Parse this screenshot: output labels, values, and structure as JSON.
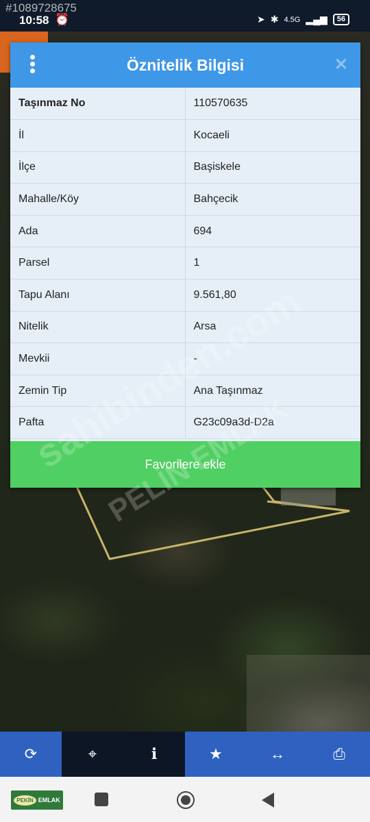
{
  "overlay_id": "#1089728675",
  "status_bar": {
    "time": "10:58",
    "network": "4.5G",
    "battery": "56"
  },
  "dialog": {
    "title": "Öznitelik Bilgisi",
    "close_symbol": "✕",
    "rows": [
      {
        "key": "Taşınmaz No",
        "value": "110570635"
      },
      {
        "key": "İl",
        "value": "Kocaeli"
      },
      {
        "key": "İlçe",
        "value": "Başiskele"
      },
      {
        "key": "Mahalle/Köy",
        "value": "Bahçecik"
      },
      {
        "key": "Ada",
        "value": "694"
      },
      {
        "key": "Parsel",
        "value": "1"
      },
      {
        "key": "Tapu Alanı",
        "value": "9.561,80"
      },
      {
        "key": "Nitelik",
        "value": "Arsa"
      },
      {
        "key": "Mevkii",
        "value": "-"
      },
      {
        "key": "Zemin Tip",
        "value": "Ana Taşınmaz"
      },
      {
        "key": "Pafta",
        "value": "G23c09a3d-D2a"
      }
    ],
    "favorite_button": "Favorilere ekle"
  },
  "watermark": {
    "line1": "sahibinden.com",
    "line2": "PELİN EMLAK"
  },
  "toolbar": {
    "items": [
      {
        "name": "refresh-icon",
        "glyph": "⟳"
      },
      {
        "name": "locate-icon",
        "glyph": "⌖"
      },
      {
        "name": "info-icon",
        "glyph": "i"
      },
      {
        "name": "star-icon",
        "glyph": "★"
      },
      {
        "name": "measure-icon",
        "glyph": "↔"
      },
      {
        "name": "print-icon",
        "glyph": "⎙"
      }
    ]
  },
  "logo": {
    "part1": "PEKİN",
    "part2": "EMLAK"
  }
}
